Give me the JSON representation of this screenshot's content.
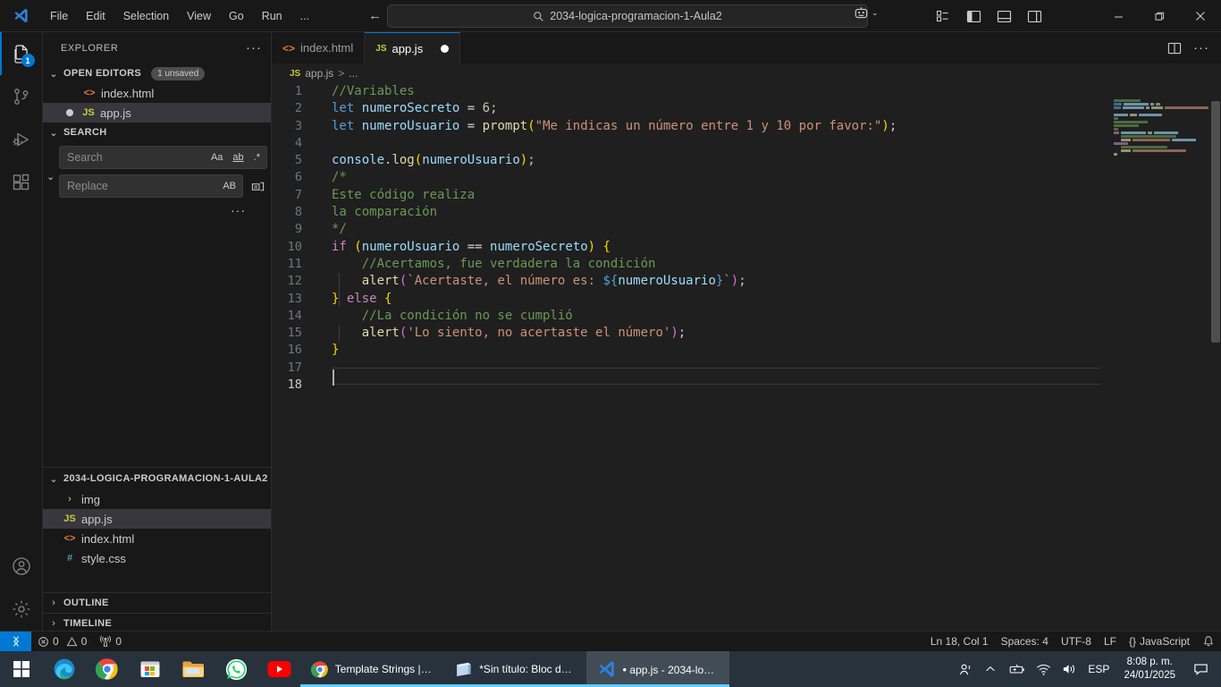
{
  "titlebar": {
    "logo_icon": "vscode-logo-icon",
    "menu": [
      "File",
      "Edit",
      "Selection",
      "View",
      "Go",
      "Run",
      "..."
    ],
    "back_icon": "arrow-left-icon",
    "forward_icon": "arrow-right-icon",
    "search": {
      "icon": "search-icon",
      "value": "2034-logica-programacion-1-Aula2"
    },
    "remote_icon": "remote-indicator-icon",
    "remote_chevron": "chevron-down-icon",
    "layout_icons": [
      "customize-layout-icon",
      "toggle-primary-sidebar-icon",
      "toggle-panel-icon",
      "toggle-secondary-sidebar-icon"
    ],
    "window_controls": {
      "minimize": "minimize-icon",
      "maximize": "restore-icon",
      "close": "close-icon"
    }
  },
  "activitybar": {
    "items": [
      {
        "name": "explorer",
        "icon": "files-icon",
        "badge": "1",
        "active": true
      },
      {
        "name": "source-control",
        "icon": "source-control-icon",
        "badge": "",
        "active": false
      },
      {
        "name": "run-and-debug",
        "icon": "debug-icon",
        "badge": "",
        "active": false
      },
      {
        "name": "extensions",
        "icon": "extensions-icon",
        "badge": "",
        "active": false
      }
    ],
    "bottom": [
      {
        "name": "accounts",
        "icon": "account-icon"
      },
      {
        "name": "settings",
        "icon": "gear-icon"
      }
    ]
  },
  "sidebar": {
    "title": "EXPLORER",
    "more_actions": "···",
    "open_editors": {
      "label": "OPEN EDITORS",
      "badge": "1 unsaved",
      "chevron": "chevron-down-icon",
      "items": [
        {
          "name": "index.html",
          "icon": "html-icon",
          "dirty": false,
          "selected": false
        },
        {
          "name": "app.js",
          "icon": "js-icon",
          "dirty": true,
          "selected": true
        }
      ]
    },
    "search": {
      "label": "SEARCH",
      "chevron": "chevron-down-icon",
      "toggle_replace_icon": "chevron-down-icon",
      "search_placeholder": "Search",
      "search_value": "",
      "replace_placeholder": "Replace",
      "replace_value": "",
      "match_case_icon": "Aa",
      "match_word_icon": "ab",
      "regex_icon": ".*",
      "preserve_case_icon": "AB",
      "replace_all_icon": "replace-all-icon",
      "more_actions": "···"
    },
    "folder": {
      "label": "2034-LOGICA-PROGRAMACION-1-AULA2",
      "chevron": "chevron-down-icon",
      "items": [
        {
          "name": "img",
          "type": "folder",
          "icon": "chevron-right-icon",
          "selected": false
        },
        {
          "name": "app.js",
          "type": "file",
          "icon": "js-icon",
          "selected": true
        },
        {
          "name": "index.html",
          "type": "file",
          "icon": "html-icon",
          "selected": false
        },
        {
          "name": "style.css",
          "type": "file",
          "icon": "css-icon",
          "selected": false
        }
      ]
    },
    "outline": {
      "label": "OUTLINE",
      "chevron": "chevron-right-icon"
    },
    "timeline": {
      "label": "TIMELINE",
      "chevron": "chevron-right-icon"
    }
  },
  "editor": {
    "tabs": [
      {
        "label": "index.html",
        "icon": "html-icon",
        "active": false,
        "dirty": false
      },
      {
        "label": "app.js",
        "icon": "js-icon",
        "active": true,
        "dirty": true
      }
    ],
    "tab_actions": [
      "split-editor-icon",
      "more-actions-icon"
    ],
    "breadcrumb": {
      "icon": "js-icon",
      "file": "app.js",
      "separator": ">",
      "symbol": "..."
    },
    "lines": [
      {
        "n": "1",
        "text": "//Variables"
      },
      {
        "n": "2",
        "text": "let numeroSecreto = 6;"
      },
      {
        "n": "3",
        "text": "let numeroUsuario = prompt(\"Me indicas un número entre 1 y 10 por favor:\");"
      },
      {
        "n": "4",
        "text": ""
      },
      {
        "n": "5",
        "text": "console.log(numeroUsuario);"
      },
      {
        "n": "6",
        "text": "/*"
      },
      {
        "n": "7",
        "text": "Este código realiza"
      },
      {
        "n": "8",
        "text": "la comparación"
      },
      {
        "n": "9",
        "text": "*/"
      },
      {
        "n": "10",
        "text": "if (numeroUsuario == numeroSecreto) {"
      },
      {
        "n": "11",
        "text": "    //Acertamos, fue verdadera la condición"
      },
      {
        "n": "12",
        "text": "    alert(`Acertaste, el número es: ${numeroUsuario}`);"
      },
      {
        "n": "13",
        "text": "} else {"
      },
      {
        "n": "14",
        "text": "    //La condición no se cumplió"
      },
      {
        "n": "15",
        "text": "    alert('Lo siento, no acertaste el número');"
      },
      {
        "n": "16",
        "text": "}"
      },
      {
        "n": "17",
        "text": ""
      },
      {
        "n": "18",
        "text": ""
      }
    ]
  },
  "statusbar": {
    "remote_icon": "remote-window-icon",
    "errors": {
      "icon": "error-icon",
      "count": "0"
    },
    "warnings": {
      "icon": "warning-icon",
      "count": "0"
    },
    "ports": {
      "icon": "radio-tower-icon",
      "count": "0"
    },
    "cursor_position": "Ln 18, Col 1",
    "indentation": "Spaces: 4",
    "encoding": "UTF-8",
    "eol": "LF",
    "language": "JavaScript",
    "language_icon": "{}",
    "notifications_icon": "bell-icon"
  },
  "taskbar": {
    "pinned": [
      {
        "name": "start-button",
        "icon": "windows-logo-icon"
      },
      {
        "name": "edge",
        "icon": "edge-icon"
      },
      {
        "name": "chrome",
        "icon": "chrome-icon"
      },
      {
        "name": "microsoft-store",
        "icon": "store-icon"
      },
      {
        "name": "file-explorer",
        "icon": "folder-icon"
      },
      {
        "name": "whatsapp",
        "icon": "whatsapp-icon"
      },
      {
        "name": "youtube",
        "icon": "youtube-icon"
      }
    ],
    "windows": [
      {
        "name": "chrome-window",
        "icon": "chrome-icon",
        "label": "Template Strings | L...",
        "active": false
      },
      {
        "name": "notepad-window",
        "icon": "notepad-icon",
        "label": "*Sin título: Bloc de ...",
        "active": false
      },
      {
        "name": "vscode-window",
        "icon": "vscode-logo-icon",
        "label": "app.js - 2034-logi...",
        "active": true,
        "dirty": true
      }
    ],
    "tray": {
      "people_icon": "people-icon",
      "chevron_icon": "chevron-up-icon",
      "battery_icon": "battery-icon",
      "wifi_icon": "wifi-icon",
      "volume_icon": "volume-icon",
      "language": "ESP",
      "time": "8:08 p. m.",
      "date": "24/01/2025",
      "notification_icon": "notification-icon"
    }
  },
  "colors": {
    "accent": "#0078d4",
    "titlebar_bg": "#181818",
    "editor_bg": "#1f1f1f",
    "taskbar_bg": "#27323d",
    "comment": "#6a9955",
    "keyword": "#569cd6",
    "string": "#ce9178",
    "function": "#dcdcaa",
    "identifier": "#9cdcfe",
    "control": "#c586c0",
    "number": "#b5cea8"
  }
}
